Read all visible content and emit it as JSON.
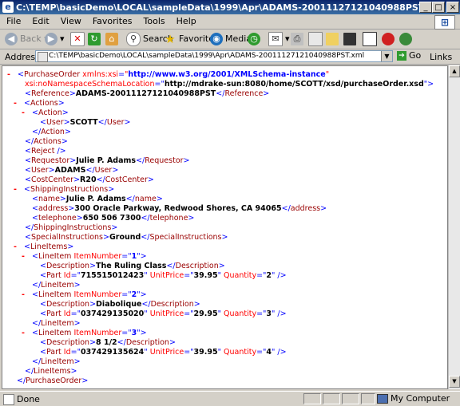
{
  "window": {
    "title": "C:\\TEMP\\basicDemo\\LOCAL\\sampleData\\1999\\Apr\\ADAMS-20011127121040988PST.xml",
    "icon_glyph": "e",
    "minimize_glyph": "_",
    "maximize_glyph": "□",
    "close_glyph": "×"
  },
  "menu": {
    "items": [
      "File",
      "Edit",
      "View",
      "Favorites",
      "Tools",
      "Help"
    ],
    "logo_glyph": "⊞"
  },
  "toolbar": {
    "back_label": "Back",
    "search_label": "Search",
    "favorites_label": "Favorites",
    "media_label": "Media"
  },
  "address": {
    "label": "Address",
    "value": "C:\\TEMP\\basicDemo\\LOCAL\\sampleData\\1999\\Apr\\ADAMS-20011127121040988PST.xml",
    "go_label": "Go",
    "links_label": "Links",
    "links_glyph": "»"
  },
  "xml": {
    "root_open": "PurchaseOrder",
    "xmlns_attr": "xmlns:xsi",
    "xmlns_value": "http://www.w3.org/2001/XMLSchema-instance",
    "schema_attr": "xsi:noNamespaceSchemaLocation",
    "schema_value": "http://mdrake-sun:8080/home/SCOTT/xsd/purchaseOrder.xsd",
    "reference": "ADAMS-20011127121040988PST",
    "action_user": "SCOTT",
    "requestor": "Julie P. Adams",
    "user": "ADAMS",
    "cost_center": "R20",
    "ship_name": "Julie P. Adams",
    "ship_address": "300 Oracle Parkway, Redwood Shores, CA 94065",
    "ship_telephone": "650 506 7300",
    "special_instructions": "Ground",
    "line_items": [
      {
        "item_number": "1",
        "description": "The Ruling Class",
        "part_id": "715515012423",
        "unit_price": "39.95",
        "quantity": "2"
      },
      {
        "item_number": "2",
        "description": "Diabolique",
        "part_id": "037429135020",
        "unit_price": "29.95",
        "quantity": "3"
      },
      {
        "item_number": "3",
        "description": "8 1/2",
        "part_id": "037429135624",
        "unit_price": "39.95",
        "quantity": "4"
      }
    ]
  },
  "status": {
    "text": "Done",
    "zone": "My Computer"
  },
  "icons": {
    "back": "back-arrow-icon",
    "forward": "forward-arrow-icon",
    "stop": "stop-icon",
    "refresh": "refresh-icon",
    "home": "home-icon",
    "search": "search-icon",
    "favorites": "favorites-star-icon",
    "media": "media-icon",
    "history": "history-icon",
    "mail": "mail-icon",
    "print": "print-icon"
  }
}
